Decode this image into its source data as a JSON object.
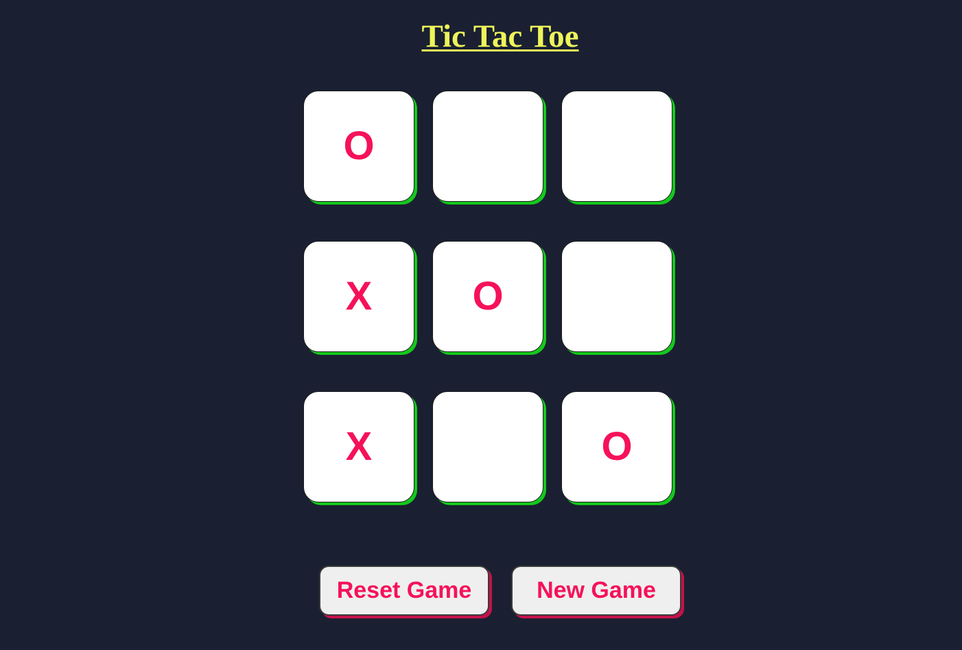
{
  "title": "Tic Tac Toe",
  "board": [
    [
      "O",
      "",
      ""
    ],
    [
      "X",
      "O",
      ""
    ],
    [
      "X",
      "",
      "O"
    ]
  ],
  "buttons": {
    "reset": "Reset Game",
    "new_game": "New Game"
  },
  "colors": {
    "background": "#1a2031",
    "title": "#eef55a",
    "mark": "#f5125a",
    "cell_shadow": "#15c81c",
    "button_shadow": "#c3124b"
  }
}
